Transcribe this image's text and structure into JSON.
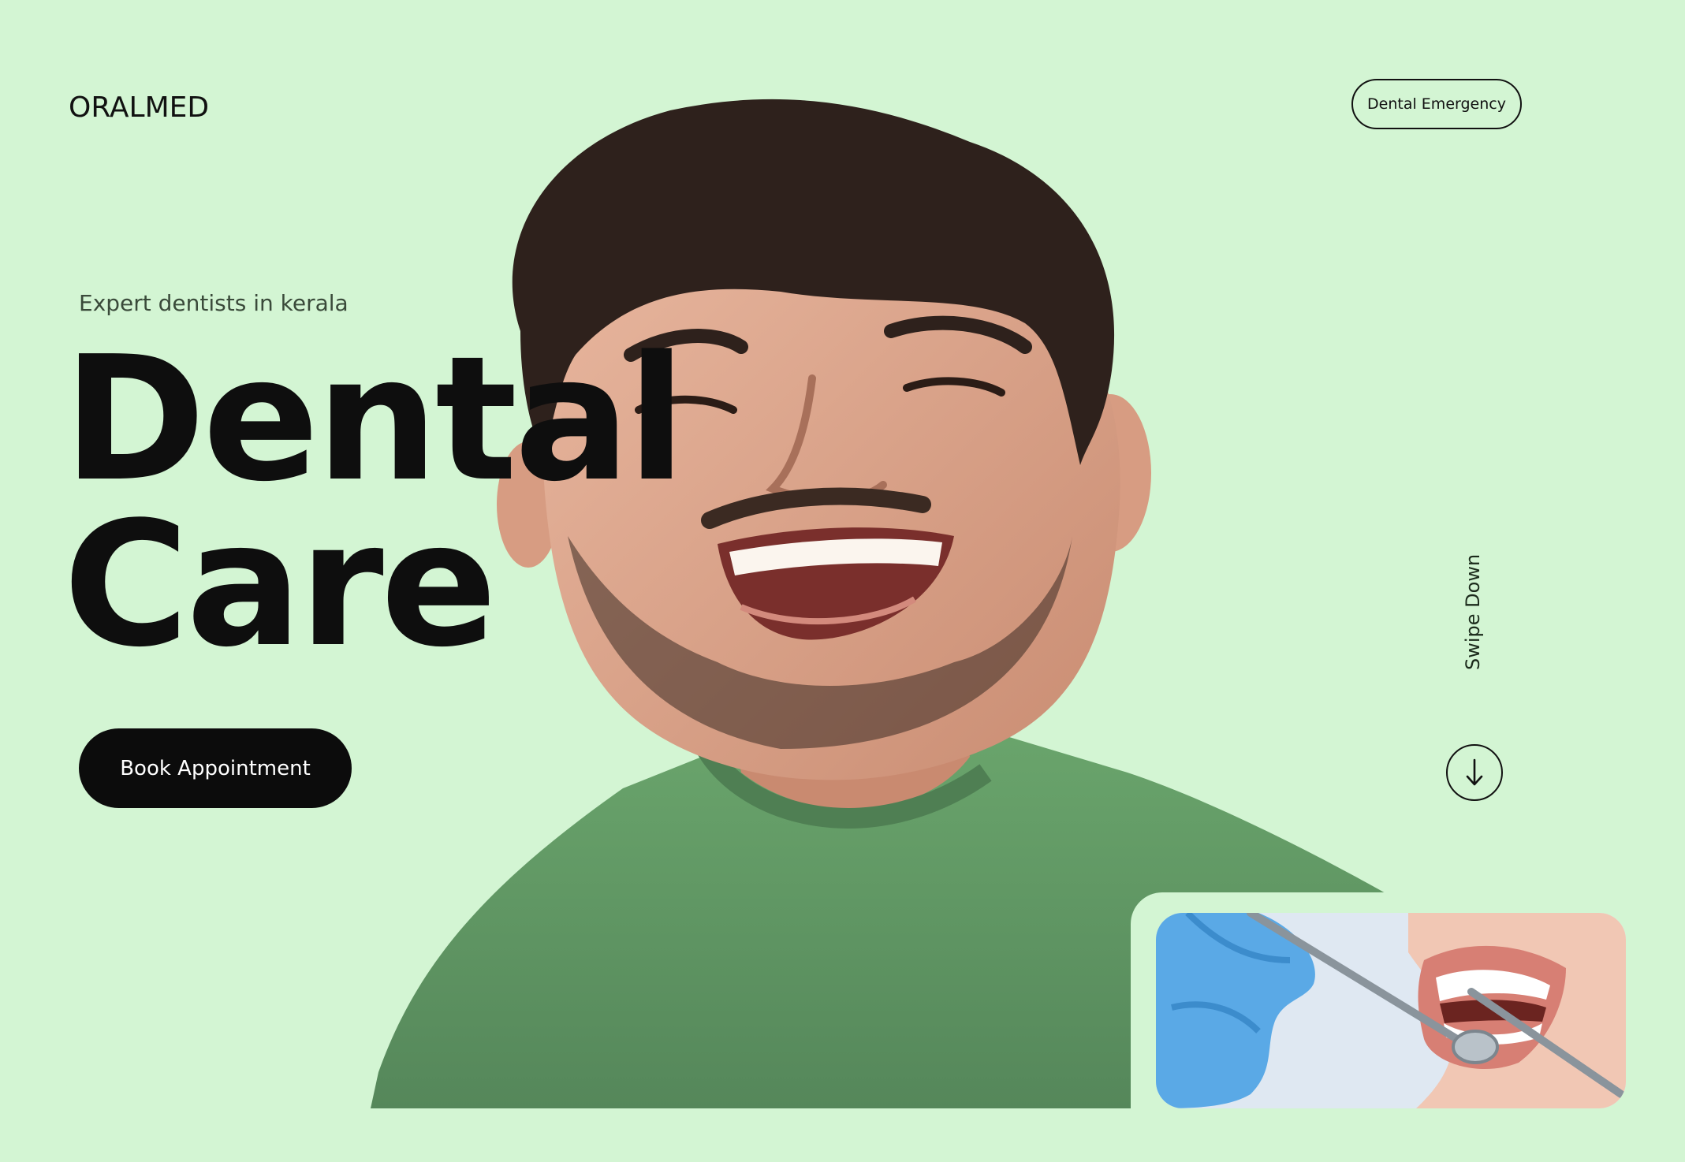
{
  "brand": {
    "logo": "ORALMED"
  },
  "header": {
    "emergency_label": "Dental Emergency"
  },
  "hero": {
    "tagline": "Expert dentists in kerala",
    "headline_line1": "Dental",
    "headline_line2": "Care",
    "cta_label": "Book Appointment"
  },
  "scroll_hint": {
    "label": "Swipe Down"
  },
  "icons": {
    "swipe": "arrow-down-icon"
  },
  "colors": {
    "background": "#d3f5d3",
    "text": "#0e0e0e",
    "button": "#0c0c0c",
    "shirt": "#5f9a62"
  }
}
